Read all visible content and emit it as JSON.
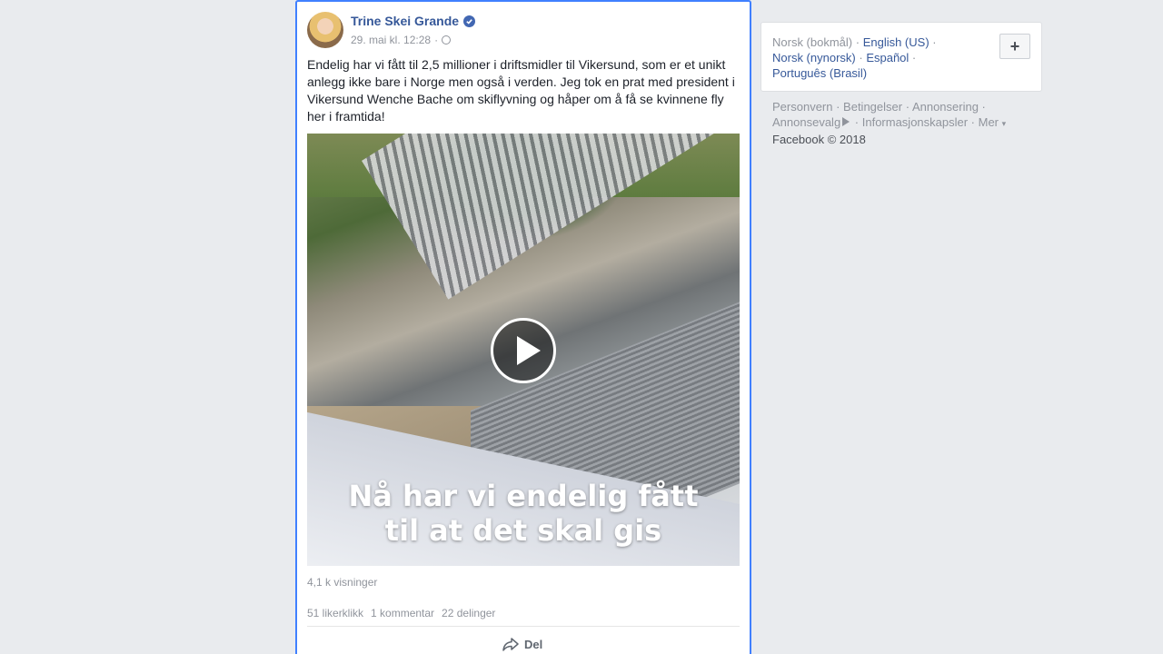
{
  "post": {
    "author": "Trine Skei Grande",
    "verified_icon": "verified-badge-icon",
    "timestamp": "29. mai kl. 12:28",
    "privacy_icon": "globe-icon",
    "text": "Endelig har vi fått til 2,5 millioner i driftsmidler til Vikersund, som er et unikt anlegg ikke bare i Norge men også i verden. Jeg tok en prat med president i Vikersund Wenche Bache om skiflyvning og håper om å få se kvinnene fly her i framtida!",
    "video": {
      "caption_line1": "Nå har vi endelig fått",
      "caption_line2": "til at det skal gis",
      "play_icon": "play-icon"
    },
    "views": "4,1 k visninger",
    "likes": "51 likerklikk",
    "comments": "1 kommentar",
    "shares": "22 delinger",
    "share_label": "Del",
    "accent_color": "#4080ff"
  },
  "sidebar": {
    "languages": {
      "current": "Norsk (bokmål)",
      "options": [
        "English (US)",
        "Norsk (nynorsk)",
        "Español",
        "Português (Brasil)"
      ],
      "add_button_label": "+"
    },
    "footer": {
      "links": [
        "Personvern",
        "Betingelser",
        "Annonsering",
        "Annonsevalg",
        "Informasjonskapsler",
        "Mer"
      ],
      "copyright": "Facebook © 2018"
    }
  }
}
